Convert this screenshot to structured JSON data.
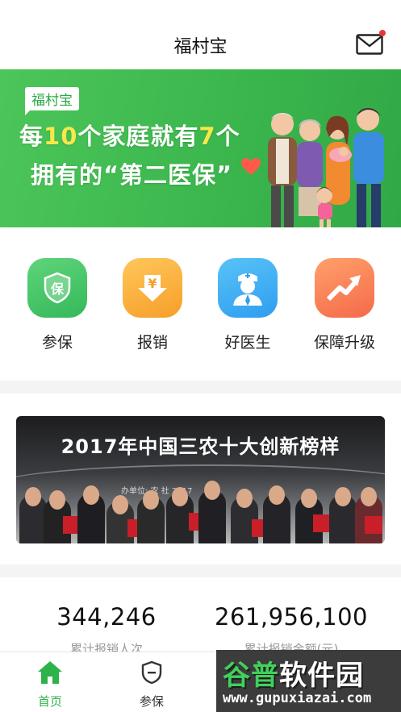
{
  "header": {
    "title": "福村宝"
  },
  "banner": {
    "brand": "福村宝",
    "line1_prefix": "每",
    "line1_num1": "10",
    "line1_mid": "个家庭就有",
    "line1_num2": "7",
    "line1_suffix": "个",
    "line2": "拥有的“第二医保”"
  },
  "actions": [
    {
      "label": "参保",
      "icon": "shield-icon",
      "glyph": "保"
    },
    {
      "label": "报销",
      "icon": "yuan-arrow-icon",
      "glyph": "¥"
    },
    {
      "label": "好医生",
      "icon": "doctor-icon"
    },
    {
      "label": "保障升级",
      "icon": "upgrade-arrow-icon"
    }
  ],
  "photo_banner": {
    "title": "2017年中国三农十大创新榜样",
    "overlay_text": "办单位: 农 社 2017"
  },
  "stats": [
    {
      "value": "344,246",
      "caption": "累计报销人次"
    },
    {
      "value": "261,956,100",
      "caption": "累计报销金额(元)"
    }
  ],
  "tabs": [
    {
      "label": "首页",
      "icon": "home-icon",
      "active": true
    },
    {
      "label": "参保",
      "icon": "shield-tab-icon",
      "active": false
    }
  ],
  "watermark": {
    "brand_1": "谷普",
    "brand_2": "软件园",
    "url": "www.gupuxiazai.com"
  },
  "colors": {
    "primary_green": "#2db34a",
    "banner_green": "#3ab54c",
    "highlight_yellow": "#f5e84a",
    "notification_red": "#e53935"
  }
}
